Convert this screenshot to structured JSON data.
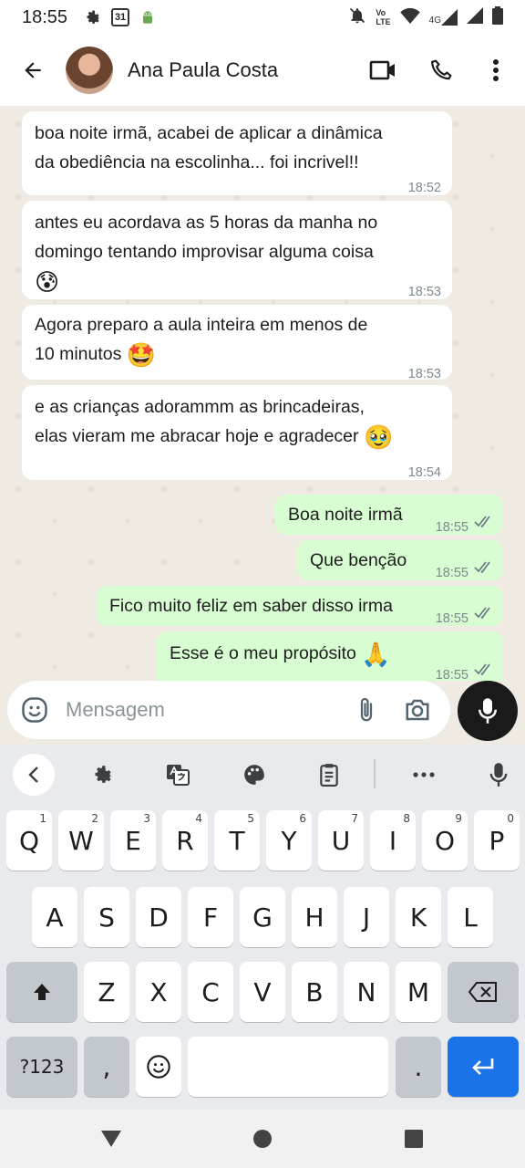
{
  "status_bar": {
    "time": "18:55",
    "calendar_day": "31",
    "network_label_top": "Vo",
    "network_label_bottom": "LTE",
    "signal_label": "4G"
  },
  "header": {
    "contact_name": "Ana Paula Costa"
  },
  "messages": [
    {
      "direction": "incoming",
      "lines": [
        "boa noite irmã, acabei de aplicar a dinâmica",
        "da obediência na escolinha... foi incrivel!!"
      ],
      "time": "18:52"
    },
    {
      "direction": "incoming",
      "lines": [
        "antes eu acordava as 5 horas da manha no",
        "domingo tentando improvisar alguma coisa"
      ],
      "emoji": "😰",
      "time": "18:53"
    },
    {
      "direction": "incoming",
      "lines": [
        "Agora preparo a aula inteira em menos de",
        "10 minutos"
      ],
      "emoji": "🤩",
      "time": "18:53"
    },
    {
      "direction": "incoming",
      "lines": [
        "e as crianças adorammm as brincadeiras,",
        "elas vieram me abracar hoje e agradecer"
      ],
      "emoji": "🥹",
      "time": "18:54"
    },
    {
      "direction": "outgoing",
      "text": "Boa noite irmã",
      "time": "18:55",
      "status": "read"
    },
    {
      "direction": "outgoing",
      "text": "Que benção",
      "time": "18:55",
      "status": "read"
    },
    {
      "direction": "outgoing",
      "text": "Fico muito feliz em saber disso irma",
      "time": "18:55",
      "status": "read"
    },
    {
      "direction": "outgoing",
      "text": "Esse é o meu propósito",
      "emoji": "🙏",
      "time": "18:55",
      "status": "read"
    }
  ],
  "composer": {
    "placeholder": "Mensagem"
  },
  "keyboard": {
    "row1": [
      {
        "key": "Q",
        "hint": "1"
      },
      {
        "key": "W",
        "hint": "2"
      },
      {
        "key": "E",
        "hint": "3"
      },
      {
        "key": "R",
        "hint": "4"
      },
      {
        "key": "T",
        "hint": "5"
      },
      {
        "key": "Y",
        "hint": "6"
      },
      {
        "key": "U",
        "hint": "7"
      },
      {
        "key": "I",
        "hint": "8"
      },
      {
        "key": "O",
        "hint": "9"
      },
      {
        "key": "P",
        "hint": "0"
      }
    ],
    "row2": [
      "A",
      "S",
      "D",
      "F",
      "G",
      "H",
      "J",
      "K",
      "L"
    ],
    "row3": [
      "Z",
      "X",
      "C",
      "V",
      "B",
      "N",
      "M"
    ],
    "symbols_key": "?123",
    "comma_key": ",",
    "period_key": "."
  },
  "colors": {
    "incoming_bubble": "#ffffff",
    "outgoing_bubble": "#d9fdd3",
    "chat_background": "#efeae2",
    "enter_key": "#1a73e8",
    "read_ticks": "#667781"
  },
  "icons": [
    "settings-gear-icon",
    "calendar-icon",
    "android-debug-icon",
    "mute-icon",
    "wifi-icon",
    "signal-icon",
    "battery-icon",
    "back-arrow-icon",
    "video-call-icon",
    "phone-icon",
    "more-vert-icon",
    "emoji-icon",
    "attach-icon",
    "camera-icon",
    "mic-icon"
  ]
}
